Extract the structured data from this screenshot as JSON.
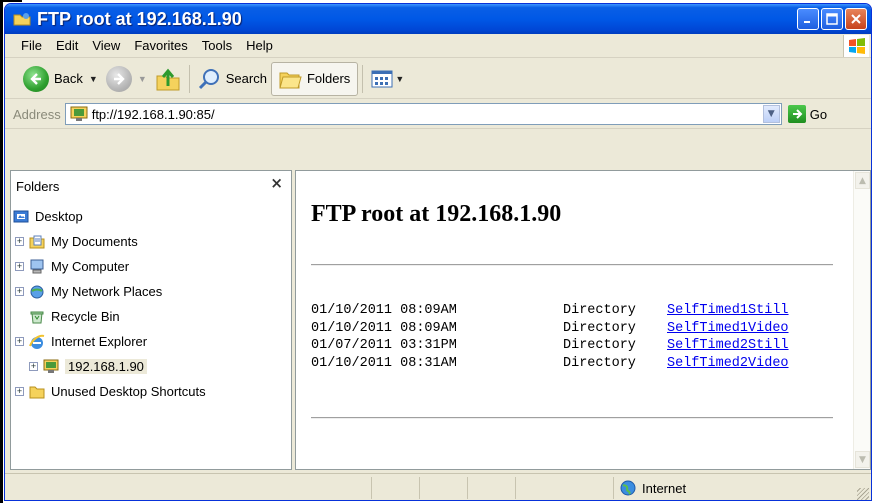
{
  "window": {
    "title": "FTP root at 192.168.1.90",
    "accent": "#0058e6"
  },
  "menu": {
    "file": "File",
    "edit": "Edit",
    "view": "View",
    "favorites": "Favorites",
    "tools": "Tools",
    "help": "Help"
  },
  "toolbar": {
    "back_label": "Back",
    "search_label": "Search",
    "folders_label": "Folders"
  },
  "address": {
    "label": "Address",
    "value": "ftp://192.168.1.90:85/",
    "go_label": "Go"
  },
  "folders_pane": {
    "title": "Folders",
    "items": [
      {
        "label": "Desktop",
        "icon": "desktop-icon"
      },
      {
        "label": "My Documents",
        "icon": "my-documents-icon"
      },
      {
        "label": "My Computer",
        "icon": "my-computer-icon"
      },
      {
        "label": "My Network Places",
        "icon": "network-places-icon"
      },
      {
        "label": "Recycle Bin",
        "icon": "recycle-bin-icon"
      },
      {
        "label": "Internet Explorer",
        "icon": "internet-explorer-icon"
      },
      {
        "label": "192.168.1.90",
        "icon": "ftp-server-icon",
        "selected": true
      },
      {
        "label": "Unused Desktop Shortcuts",
        "icon": "folder-icon"
      }
    ]
  },
  "content": {
    "heading": "FTP root at 192.168.1.90",
    "entries": [
      {
        "date": "01/10/2011 08:09AM",
        "type": "Directory",
        "name": "SelfTimed1Still"
      },
      {
        "date": "01/10/2011 08:09AM",
        "type": "Directory",
        "name": "SelfTimed1Video"
      },
      {
        "date": "01/07/2011 03:31PM",
        "type": "Directory",
        "name": "SelfTimed2Still"
      },
      {
        "date": "01/10/2011 08:31AM",
        "type": "Directory",
        "name": "SelfTimed2Video"
      }
    ]
  },
  "status": {
    "zone": "Internet"
  }
}
